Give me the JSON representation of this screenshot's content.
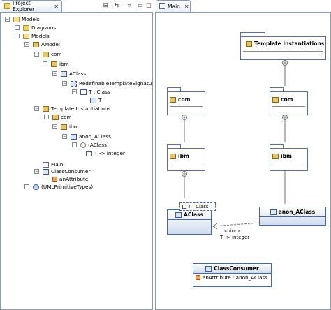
{
  "explorer": {
    "tab_label": "Project Explorer",
    "close_glyph": "✕",
    "toolbar_icons": [
      "collapse-all-icon",
      "link-editor-icon",
      "view-menu-icon"
    ],
    "tree": [
      {
        "label": "Models",
        "icon": "folder-icon"
      },
      {
        "label": "Diagrams",
        "icon": "folder-icon"
      },
      {
        "label": "Models",
        "icon": "folder-icon"
      },
      {
        "label": "AModel",
        "icon": "model-icon"
      },
      {
        "label": "com",
        "icon": "package-icon"
      },
      {
        "label": "ibm",
        "icon": "package-icon"
      },
      {
        "label": "AClass",
        "icon": "class-icon"
      },
      {
        "label": "RedefinableTemplateSignatu",
        "icon": "template-signature-icon"
      },
      {
        "label": "T : Class",
        "icon": "template-parameter-icon"
      },
      {
        "label": "T",
        "icon": "class-icon"
      },
      {
        "label": "Template Instantiations",
        "icon": "package-icon"
      },
      {
        "label": "com",
        "icon": "package-icon"
      },
      {
        "label": "ibm",
        "icon": "package-icon"
      },
      {
        "label": "anon_AClass",
        "icon": "class-icon"
      },
      {
        "label": "(AClass)",
        "icon": "template-binding-icon"
      },
      {
        "label": "T -> integer",
        "icon": "parameter-substitution-icon"
      },
      {
        "label": "Main",
        "icon": "diagram-icon"
      },
      {
        "label": "ClassConsumer",
        "icon": "class-icon"
      },
      {
        "label": "anAttribute",
        "icon": "attribute-icon"
      },
      {
        "label": "(UMLPrimitiveTypes)",
        "icon": "library-icon"
      }
    ]
  },
  "editor": {
    "tab_label": "Main",
    "close_glyph": "✕"
  },
  "diagram": {
    "template_instantiations": "Template Instantiations",
    "com_left": "com",
    "ibm_left": "ibm",
    "com_right": "com",
    "ibm_right": "ibm",
    "aclass": "AClass",
    "template_param": "T : Class",
    "anon_aclass": "anon_AClass",
    "bind_label": "«bind»",
    "bind_substitution": "T -> integer",
    "class_consumer": "ClassConsumer",
    "consumer_attribute": "anAttribute : anon_AClass"
  },
  "colors": {
    "frame": "#8a9bb5",
    "class_fill": "#cfdcee",
    "class_border": "#4a6a98",
    "package_border": "#5d6f8e"
  }
}
